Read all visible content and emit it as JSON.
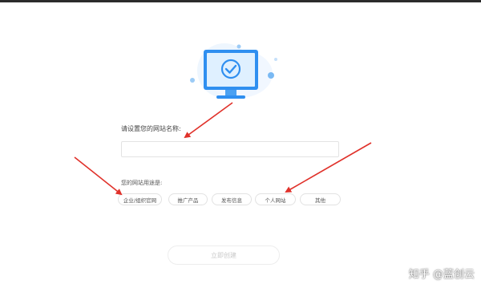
{
  "form": {
    "name_label": "请设置您的网站名称:",
    "name_value": "",
    "purpose_label": "您的网站用途是:",
    "options": [
      "企业/组织官网",
      "推广产品",
      "发布信息",
      "个人网站",
      "其他"
    ],
    "submit_label": "立即创建"
  },
  "watermark": "知乎 @蓝创云",
  "colors": {
    "accent": "#2f8ff0",
    "arrow": "#e0312a",
    "border": "#e2e2e2"
  }
}
